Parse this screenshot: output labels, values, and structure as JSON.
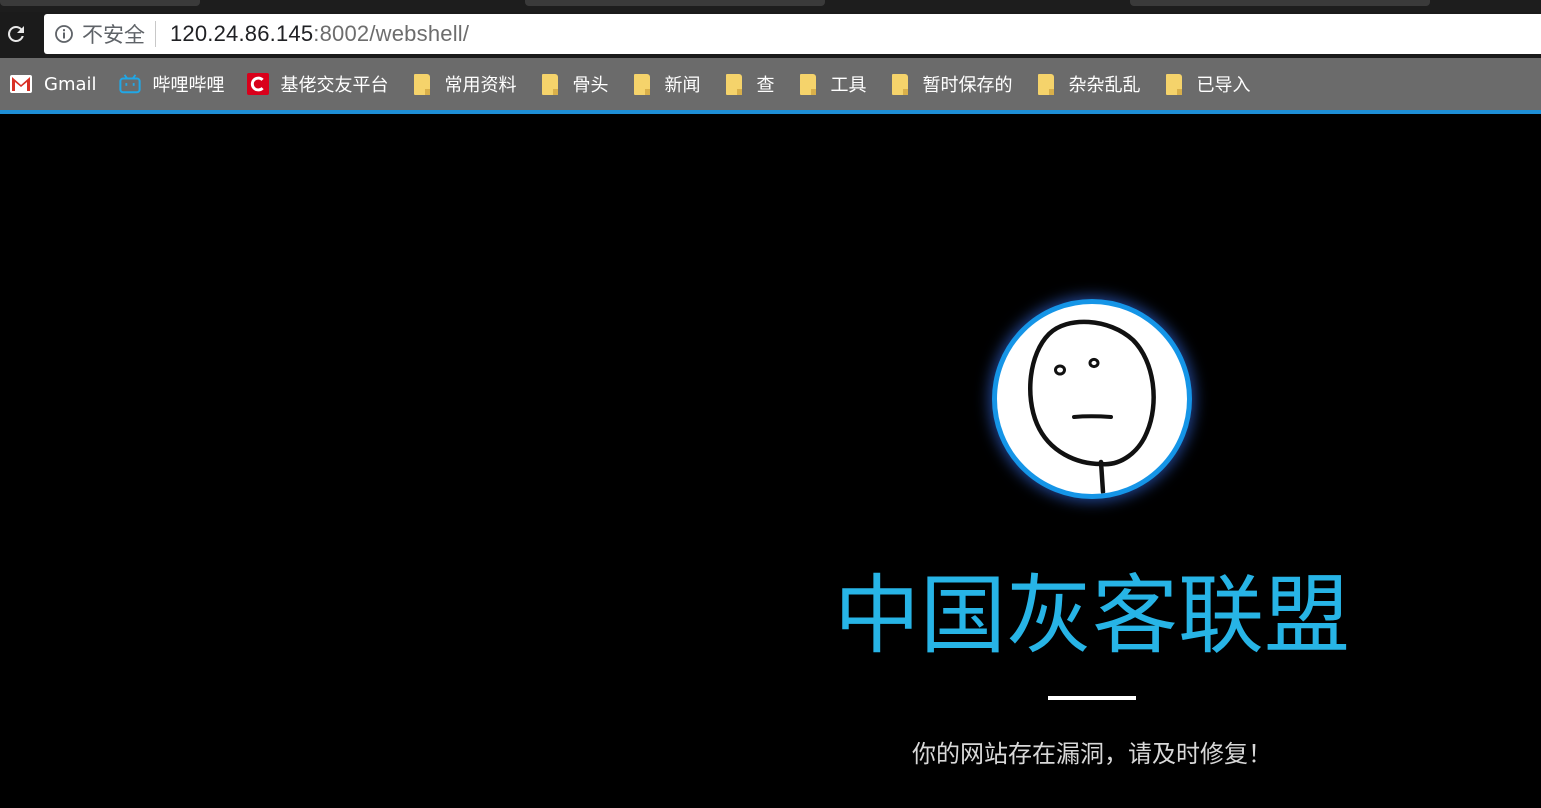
{
  "browser": {
    "security_label": "不安全",
    "url_host": "120.24.86.145",
    "url_rest": ":8002/webshell/"
  },
  "bookmarks": [
    {
      "label": "Gmail",
      "icon": "gmail-icon"
    },
    {
      "label": "哔哩哔哩",
      "icon": "bilibili-icon"
    },
    {
      "label": "基佬交友平台",
      "icon": "csdn-icon"
    },
    {
      "label": "常用资料",
      "icon": "folder-icon"
    },
    {
      "label": "骨头",
      "icon": "folder-icon"
    },
    {
      "label": "新闻",
      "icon": "folder-icon"
    },
    {
      "label": "查",
      "icon": "folder-icon"
    },
    {
      "label": "工具",
      "icon": "folder-icon"
    },
    {
      "label": "暂时保存的",
      "icon": "folder-icon"
    },
    {
      "label": "杂杂乱乱",
      "icon": "folder-icon"
    },
    {
      "label": "已导入",
      "icon": "folder-icon"
    }
  ],
  "page": {
    "title": "中国灰客联盟",
    "message": "你的网站存在漏洞，请及时修复！"
  },
  "colors": {
    "accent": "#1595e7",
    "title": "#27b4e6",
    "bookmark_bar": "#6b6b6b",
    "background": "#000000"
  }
}
